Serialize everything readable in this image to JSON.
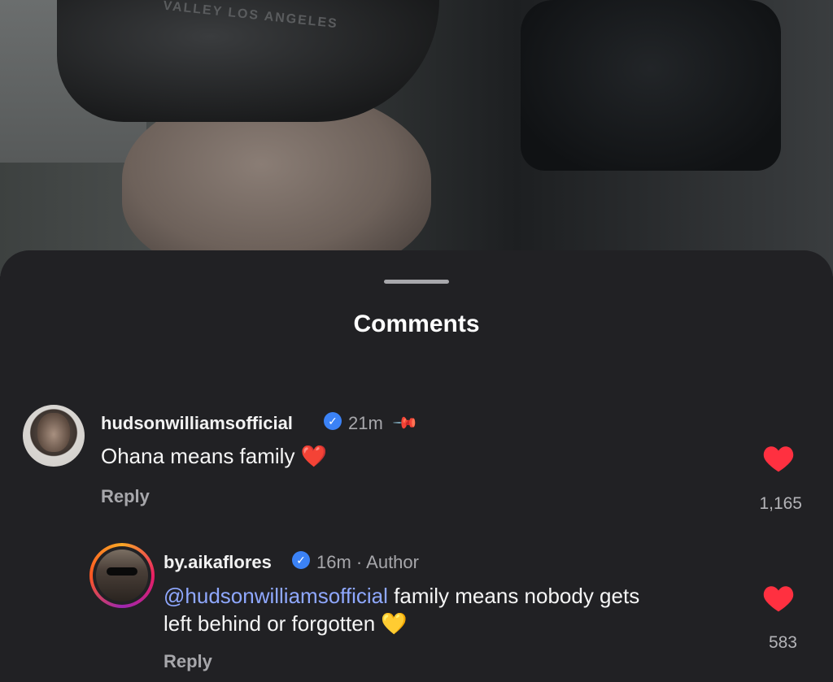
{
  "video": {
    "cap_text": "VALLEY LOS ANGELES"
  },
  "sheet": {
    "title": "Comments"
  },
  "comments": [
    {
      "username": "hudsonwilliamsofficial",
      "verified": true,
      "time": "21m",
      "pinned": true,
      "text": "Ohana means family",
      "emoji": "❤️",
      "reply_label": "Reply",
      "likes": "1,165"
    },
    {
      "username": "by.aikaflores",
      "verified": true,
      "time": "16m",
      "separator": "·",
      "role": "Author",
      "mention": "@hudsonwilliamsofficial",
      "text_line1": "family means nobody gets",
      "text_line2": "left behind or forgotten",
      "emoji": "💛",
      "reply_label": "Reply",
      "likes": "583"
    }
  ],
  "icons": {
    "verified": "verified-badge-icon",
    "pin": "pin-icon",
    "like": "heart-icon"
  },
  "colors": {
    "sheet_bg": "#212124",
    "like_red": "#ff3040",
    "verified_blue": "#3b82f6",
    "mention_blue": "#8fa8ff"
  }
}
